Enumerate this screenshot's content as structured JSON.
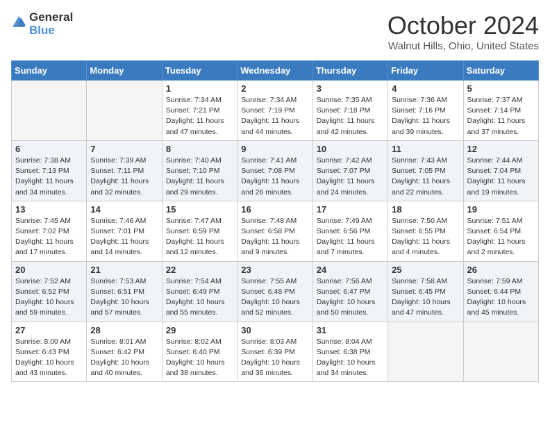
{
  "header": {
    "logo_general": "General",
    "logo_blue": "Blue",
    "month": "October 2024",
    "location": "Walnut Hills, Ohio, United States"
  },
  "weekdays": [
    "Sunday",
    "Monday",
    "Tuesday",
    "Wednesday",
    "Thursday",
    "Friday",
    "Saturday"
  ],
  "weeks": [
    [
      {
        "day": "",
        "sunrise": "",
        "sunset": "",
        "daylight": "",
        "empty": true
      },
      {
        "day": "",
        "sunrise": "",
        "sunset": "",
        "daylight": "",
        "empty": true
      },
      {
        "day": "1",
        "sunrise": "Sunrise: 7:34 AM",
        "sunset": "Sunset: 7:21 PM",
        "daylight": "Daylight: 11 hours and 47 minutes."
      },
      {
        "day": "2",
        "sunrise": "Sunrise: 7:34 AM",
        "sunset": "Sunset: 7:19 PM",
        "daylight": "Daylight: 11 hours and 44 minutes."
      },
      {
        "day": "3",
        "sunrise": "Sunrise: 7:35 AM",
        "sunset": "Sunset: 7:18 PM",
        "daylight": "Daylight: 11 hours and 42 minutes."
      },
      {
        "day": "4",
        "sunrise": "Sunrise: 7:36 AM",
        "sunset": "Sunset: 7:16 PM",
        "daylight": "Daylight: 11 hours and 39 minutes."
      },
      {
        "day": "5",
        "sunrise": "Sunrise: 7:37 AM",
        "sunset": "Sunset: 7:14 PM",
        "daylight": "Daylight: 11 hours and 37 minutes."
      }
    ],
    [
      {
        "day": "6",
        "sunrise": "Sunrise: 7:38 AM",
        "sunset": "Sunset: 7:13 PM",
        "daylight": "Daylight: 11 hours and 34 minutes."
      },
      {
        "day": "7",
        "sunrise": "Sunrise: 7:39 AM",
        "sunset": "Sunset: 7:11 PM",
        "daylight": "Daylight: 11 hours and 32 minutes."
      },
      {
        "day": "8",
        "sunrise": "Sunrise: 7:40 AM",
        "sunset": "Sunset: 7:10 PM",
        "daylight": "Daylight: 11 hours and 29 minutes."
      },
      {
        "day": "9",
        "sunrise": "Sunrise: 7:41 AM",
        "sunset": "Sunset: 7:08 PM",
        "daylight": "Daylight: 11 hours and 26 minutes."
      },
      {
        "day": "10",
        "sunrise": "Sunrise: 7:42 AM",
        "sunset": "Sunset: 7:07 PM",
        "daylight": "Daylight: 11 hours and 24 minutes."
      },
      {
        "day": "11",
        "sunrise": "Sunrise: 7:43 AM",
        "sunset": "Sunset: 7:05 PM",
        "daylight": "Daylight: 11 hours and 22 minutes."
      },
      {
        "day": "12",
        "sunrise": "Sunrise: 7:44 AM",
        "sunset": "Sunset: 7:04 PM",
        "daylight": "Daylight: 11 hours and 19 minutes."
      }
    ],
    [
      {
        "day": "13",
        "sunrise": "Sunrise: 7:45 AM",
        "sunset": "Sunset: 7:02 PM",
        "daylight": "Daylight: 11 hours and 17 minutes."
      },
      {
        "day": "14",
        "sunrise": "Sunrise: 7:46 AM",
        "sunset": "Sunset: 7:01 PM",
        "daylight": "Daylight: 11 hours and 14 minutes."
      },
      {
        "day": "15",
        "sunrise": "Sunrise: 7:47 AM",
        "sunset": "Sunset: 6:59 PM",
        "daylight": "Daylight: 11 hours and 12 minutes."
      },
      {
        "day": "16",
        "sunrise": "Sunrise: 7:48 AM",
        "sunset": "Sunset: 6:58 PM",
        "daylight": "Daylight: 11 hours and 9 minutes."
      },
      {
        "day": "17",
        "sunrise": "Sunrise: 7:49 AM",
        "sunset": "Sunset: 6:56 PM",
        "daylight": "Daylight: 11 hours and 7 minutes."
      },
      {
        "day": "18",
        "sunrise": "Sunrise: 7:50 AM",
        "sunset": "Sunset: 6:55 PM",
        "daylight": "Daylight: 11 hours and 4 minutes."
      },
      {
        "day": "19",
        "sunrise": "Sunrise: 7:51 AM",
        "sunset": "Sunset: 6:54 PM",
        "daylight": "Daylight: 11 hours and 2 minutes."
      }
    ],
    [
      {
        "day": "20",
        "sunrise": "Sunrise: 7:52 AM",
        "sunset": "Sunset: 6:52 PM",
        "daylight": "Daylight: 10 hours and 59 minutes."
      },
      {
        "day": "21",
        "sunrise": "Sunrise: 7:53 AM",
        "sunset": "Sunset: 6:51 PM",
        "daylight": "Daylight: 10 hours and 57 minutes."
      },
      {
        "day": "22",
        "sunrise": "Sunrise: 7:54 AM",
        "sunset": "Sunset: 6:49 PM",
        "daylight": "Daylight: 10 hours and 55 minutes."
      },
      {
        "day": "23",
        "sunrise": "Sunrise: 7:55 AM",
        "sunset": "Sunset: 6:48 PM",
        "daylight": "Daylight: 10 hours and 52 minutes."
      },
      {
        "day": "24",
        "sunrise": "Sunrise: 7:56 AM",
        "sunset": "Sunset: 6:47 PM",
        "daylight": "Daylight: 10 hours and 50 minutes."
      },
      {
        "day": "25",
        "sunrise": "Sunrise: 7:58 AM",
        "sunset": "Sunset: 6:45 PM",
        "daylight": "Daylight: 10 hours and 47 minutes."
      },
      {
        "day": "26",
        "sunrise": "Sunrise: 7:59 AM",
        "sunset": "Sunset: 6:44 PM",
        "daylight": "Daylight: 10 hours and 45 minutes."
      }
    ],
    [
      {
        "day": "27",
        "sunrise": "Sunrise: 8:00 AM",
        "sunset": "Sunset: 6:43 PM",
        "daylight": "Daylight: 10 hours and 43 minutes."
      },
      {
        "day": "28",
        "sunrise": "Sunrise: 8:01 AM",
        "sunset": "Sunset: 6:42 PM",
        "daylight": "Daylight: 10 hours and 40 minutes."
      },
      {
        "day": "29",
        "sunrise": "Sunrise: 8:02 AM",
        "sunset": "Sunset: 6:40 PM",
        "daylight": "Daylight: 10 hours and 38 minutes."
      },
      {
        "day": "30",
        "sunrise": "Sunrise: 8:03 AM",
        "sunset": "Sunset: 6:39 PM",
        "daylight": "Daylight: 10 hours and 36 minutes."
      },
      {
        "day": "31",
        "sunrise": "Sunrise: 8:04 AM",
        "sunset": "Sunset: 6:38 PM",
        "daylight": "Daylight: 10 hours and 34 minutes."
      },
      {
        "day": "",
        "sunrise": "",
        "sunset": "",
        "daylight": "",
        "empty": true
      },
      {
        "day": "",
        "sunrise": "",
        "sunset": "",
        "daylight": "",
        "empty": true
      }
    ]
  ]
}
